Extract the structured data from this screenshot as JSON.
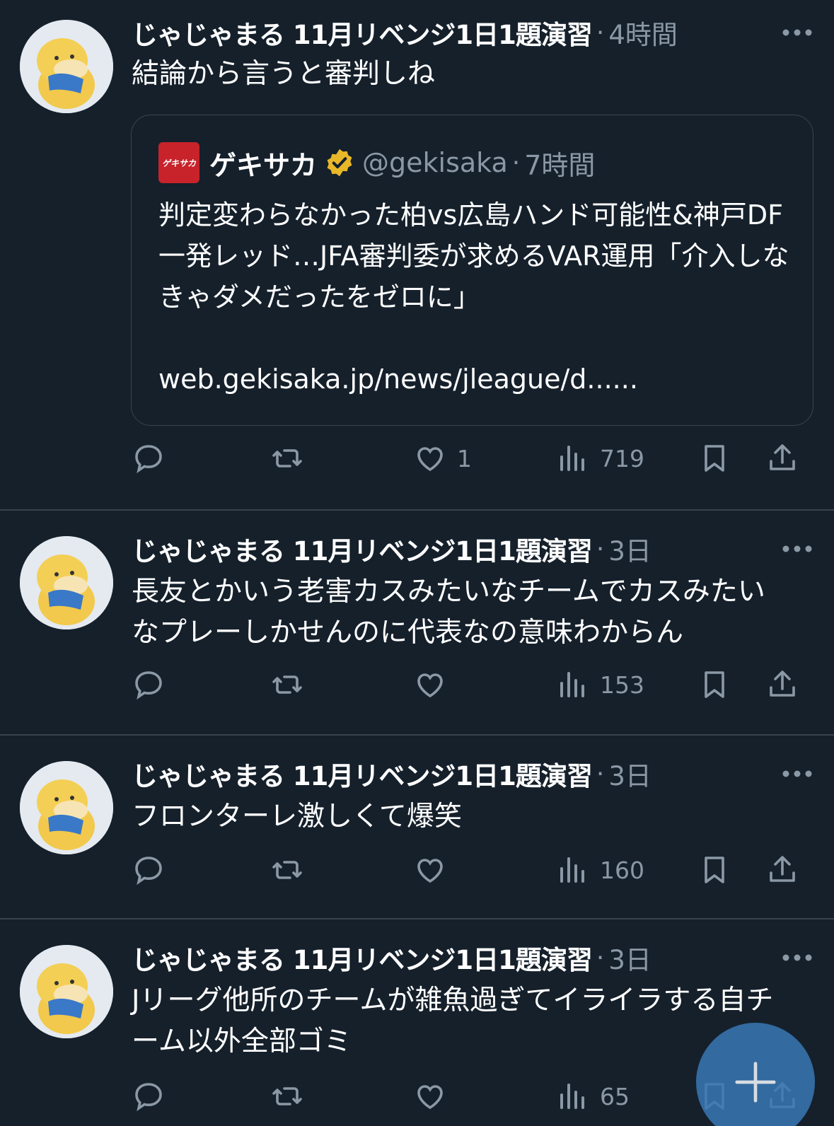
{
  "colors": {
    "background": "#15202b",
    "divider": "#38444d",
    "secondary_text": "#8b98a5",
    "fab": "#3878b4",
    "verified_badge": "#e8b829",
    "logo_red": "#c8222a"
  },
  "tweets": [
    {
      "name": "じゃじゃまる 11月リベンジ1日1題演習",
      "time": "4時間",
      "text": "結論から言うと審判しね",
      "quote": {
        "logo_text": "ゲキサカ",
        "name": "ゲキサカ",
        "handle": "@gekisaka",
        "time": "7時間",
        "text": "判定変わらなかった柏vs広島ハンド可能性&神戸DF一発レッド…JFA審判委が求めるVAR運用「介入しなきゃダメだったをゼロに」\n\nweb.gekisaka.jp/news/jleague/d......"
      },
      "likes": "1",
      "views": "719"
    },
    {
      "name": "じゃじゃまる 11月リベンジ1日1題演習",
      "time": "3日",
      "text": "長友とかいう老害カスみたいなチームでカスみたいなプレーしかせんのに代表なの意味わからん",
      "likes": "",
      "views": "153"
    },
    {
      "name": "じゃじゃまる 11月リベンジ1日1題演習",
      "time": "3日",
      "text": "フロンターレ激しくて爆笑",
      "likes": "",
      "views": "160"
    },
    {
      "name": "じゃじゃまる 11月リベンジ1日1題演習",
      "time": "3日",
      "text": "Jリーグ他所のチームが雑魚過ぎてイライラする自チーム以外全部ゴミ",
      "likes": "",
      "views": "65"
    }
  ],
  "icons": {
    "reply": "reply-icon",
    "retweet": "retweet-icon",
    "like": "heart-icon",
    "views": "views-icon",
    "bookmark": "bookmark-icon",
    "share": "share-icon",
    "more": "more-icon",
    "compose": "plus-icon"
  }
}
